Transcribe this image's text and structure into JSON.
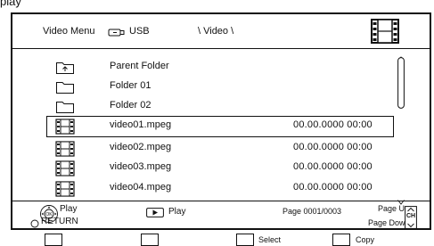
{
  "top_fragment": "play",
  "header": {
    "title": "Video Menu",
    "device_icon": "usb-drive-icon",
    "device": "USB",
    "path": "\\ Video \\",
    "mode_icon": "film-strip-icon"
  },
  "items": [
    {
      "icon": "parent-folder-icon",
      "name": "Parent Folder",
      "date": ""
    },
    {
      "icon": "folder-icon",
      "name": "Folder 01",
      "date": ""
    },
    {
      "icon": "folder-icon",
      "name": "Folder 02",
      "date": ""
    },
    {
      "icon": "film-strip-icon",
      "name": "video01.mpeg",
      "date": "00.00.0000 00:00",
      "selected": true
    },
    {
      "icon": "film-strip-icon",
      "name": "video02.mpeg",
      "date": "00.00.0000 00:00"
    },
    {
      "icon": "film-strip-icon",
      "name": "video03.mpeg",
      "date": "00.00.0000 00:00"
    },
    {
      "icon": "film-strip-icon",
      "name": "video04.mpeg",
      "date": "00.00.0000 00:00"
    }
  ],
  "footer": {
    "play_label": "Play",
    "return_label": "RETURN",
    "play_button_label": "Play",
    "page_info": "Page 0001/0003",
    "page_up": "Page Up",
    "page_down": "Page Down",
    "ch_label": "CH"
  },
  "color_buttons": {
    "select_label": "Select",
    "copy_label": "Copy"
  },
  "colors": {
    "line": "#111111",
    "scroll": "#888888"
  }
}
